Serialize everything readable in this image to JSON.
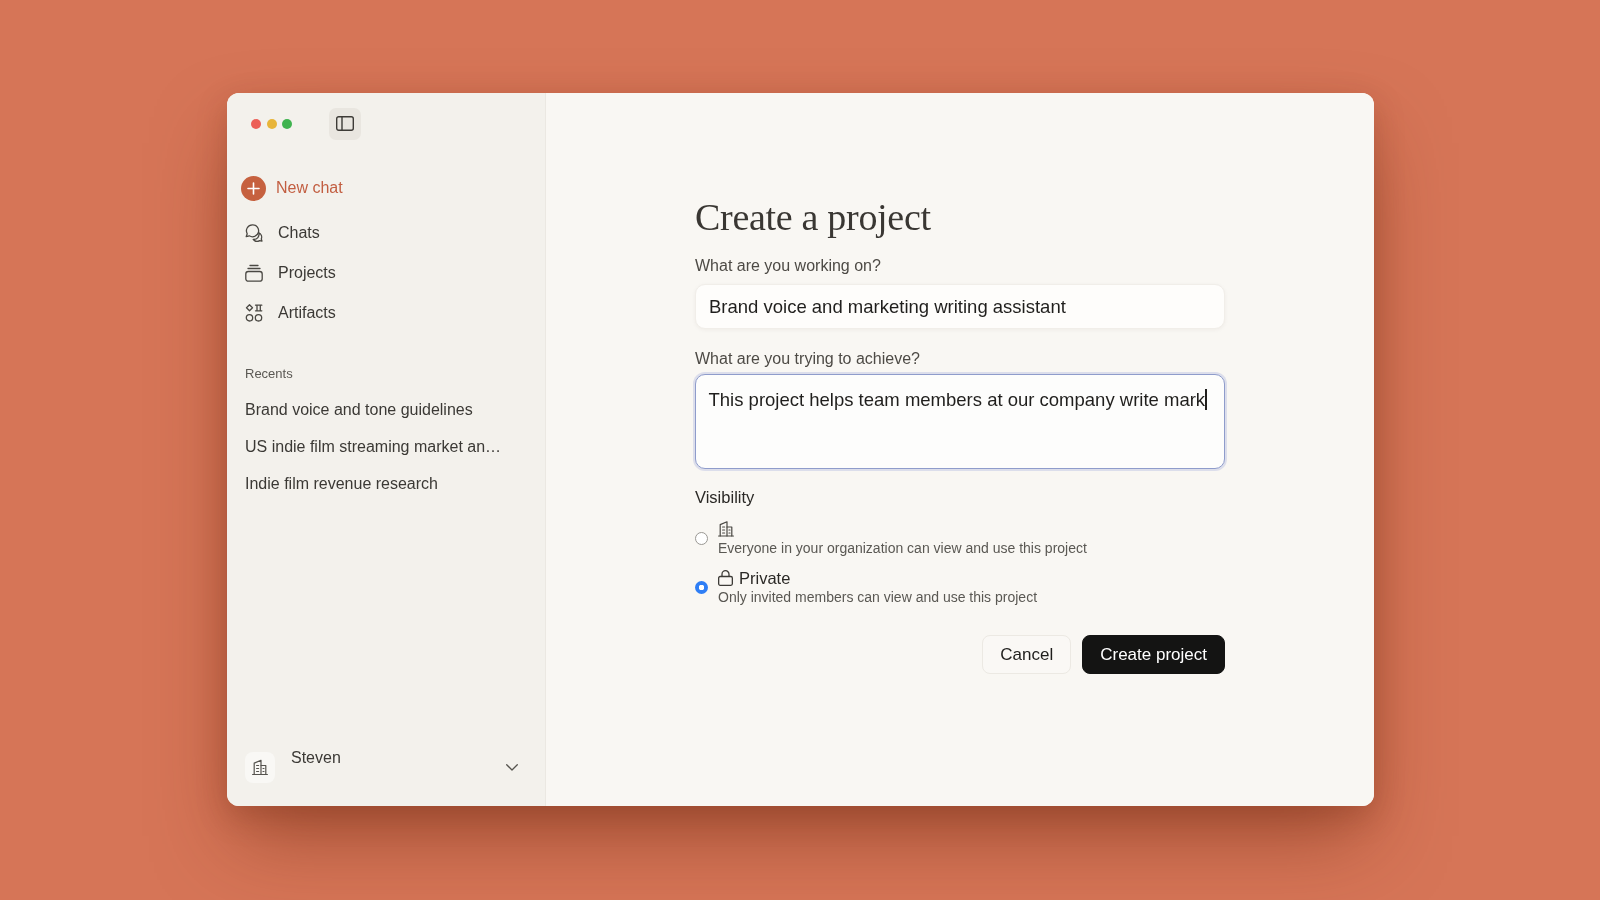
{
  "sidebar": {
    "new_chat": {
      "label": "New chat"
    },
    "nav": [
      {
        "label": "Chats"
      },
      {
        "label": "Projects"
      },
      {
        "label": "Artifacts"
      }
    ],
    "recents": {
      "heading": "Recents",
      "items": [
        {
          "label": "Brand voice and tone guidelines"
        },
        {
          "label": "US indie film streaming market an…"
        },
        {
          "label": "Indie film revenue research"
        }
      ]
    },
    "account": {
      "name": "Steven"
    }
  },
  "form": {
    "title": "Create a project",
    "fields": [
      {
        "kind": "input",
        "label": "What are you working on?",
        "value": "Brand voice and marketing writing assistant",
        "focused": false
      },
      {
        "kind": "textarea",
        "label": "What are you trying to achieve?",
        "value": "This project helps team members at our company write mark",
        "focused": true
      }
    ],
    "visibility": {
      "heading": "Visibility",
      "options": [
        {
          "kind": "organization",
          "description": "Everyone in your organization can view and use this project",
          "selected": false
        },
        {
          "kind": "private",
          "title": "Private",
          "description": "Only invited members can view and use this project",
          "selected": true
        }
      ]
    },
    "buttons": [
      {
        "kind": "secondary",
        "label": "Cancel"
      },
      {
        "kind": "primary",
        "label": "Create project"
      }
    ]
  }
}
